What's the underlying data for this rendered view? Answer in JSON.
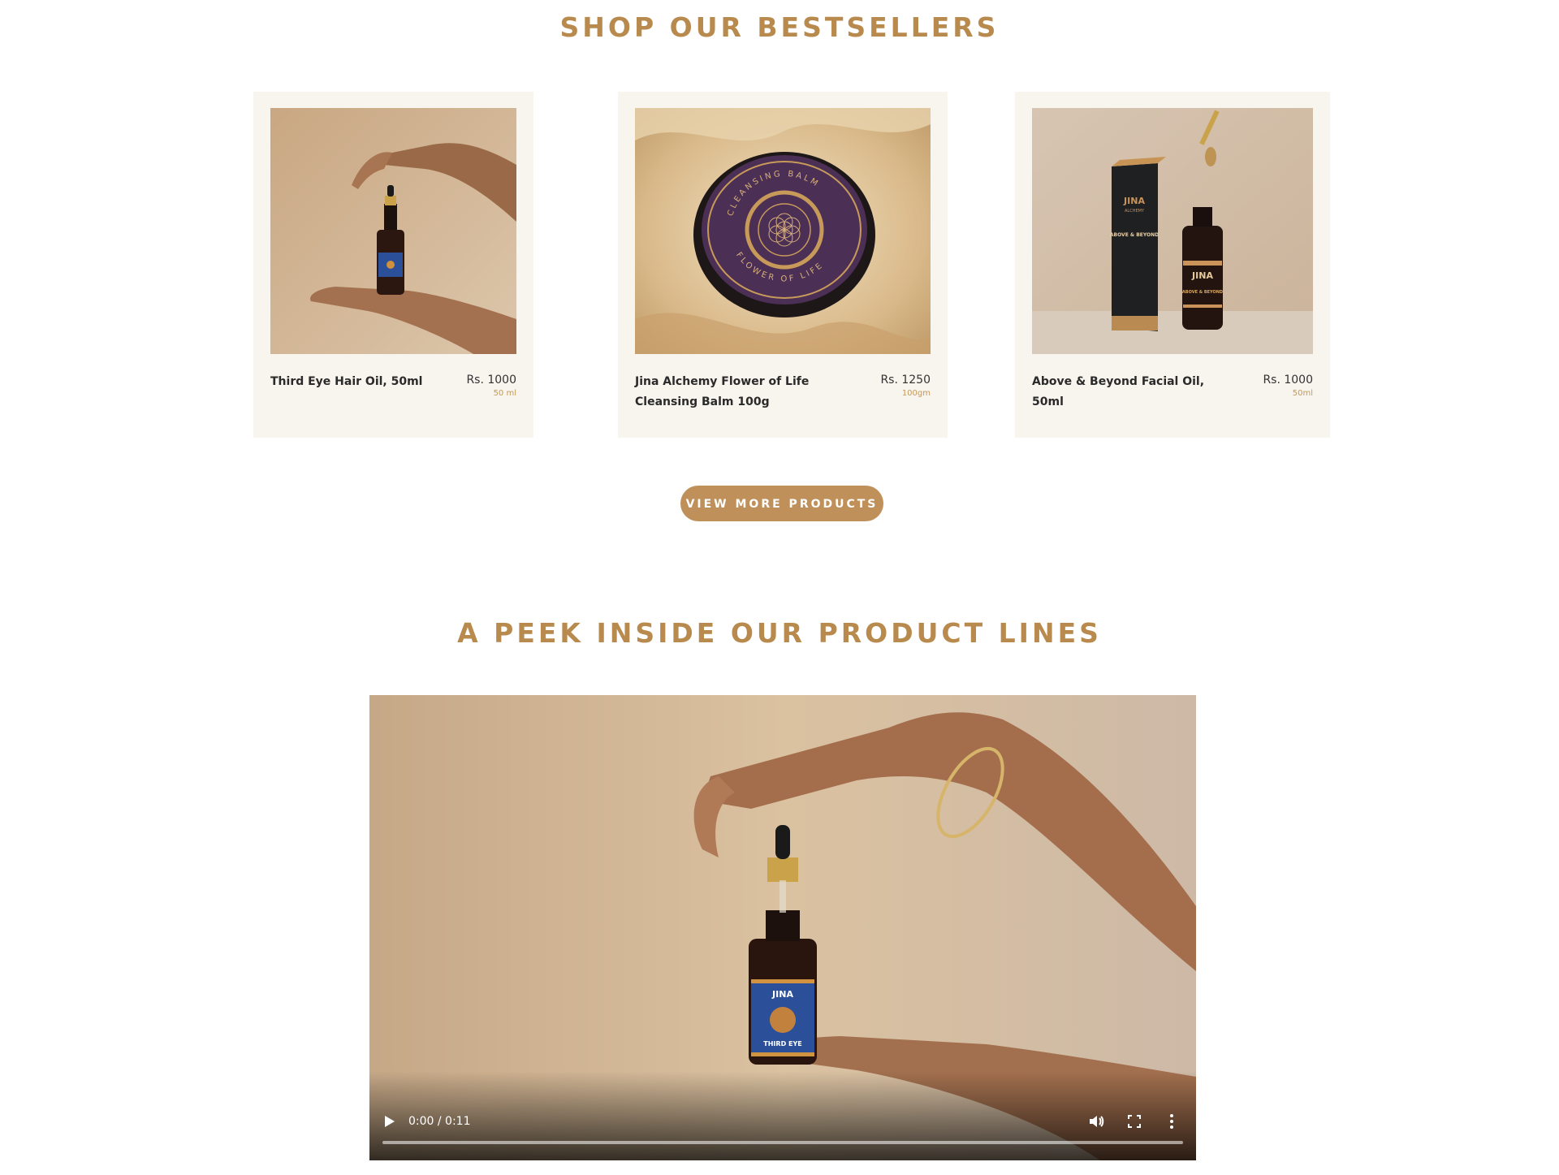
{
  "bestsellers": {
    "title": "SHOP OUR BESTSELLERS",
    "products": [
      {
        "name": "Third Eye Hair Oil, 50ml",
        "price": "Rs. 1000",
        "size": "50 ml"
      },
      {
        "name": "Jina Alchemy Flower of Life Cleansing Balm 100g",
        "price": "Rs. 1250",
        "size": "100gm"
      },
      {
        "name": "Above & Beyond Facial Oil, 50ml",
        "price": "Rs. 1000",
        "size": "50ml"
      }
    ],
    "view_more_label": "VIEW MORE PRODUCTS"
  },
  "product_lines": {
    "title": "A PEEK INSIDE OUR PRODUCT LINES",
    "video": {
      "time": "0:00 / 0:11",
      "progress": 0
    }
  },
  "labels": {
    "balm_top": "CLEANSING BALM",
    "balm_bottom": "FLOWER OF LIFE",
    "brand": "JINA",
    "brand_sub": "ALCHEMY",
    "box_product": "ABOVE & BEYOND",
    "bottle_product_short": "ABOVE & BEYOND",
    "third_eye": "THIRD EYE"
  },
  "colors": {
    "accent": "#b88a4e",
    "button": "#c0905a",
    "card_bg": "#f8f4ee"
  },
  "icons": {
    "play": "play-icon",
    "volume": "volume-icon",
    "fullscreen": "fullscreen-icon",
    "more": "more-vert-icon"
  }
}
